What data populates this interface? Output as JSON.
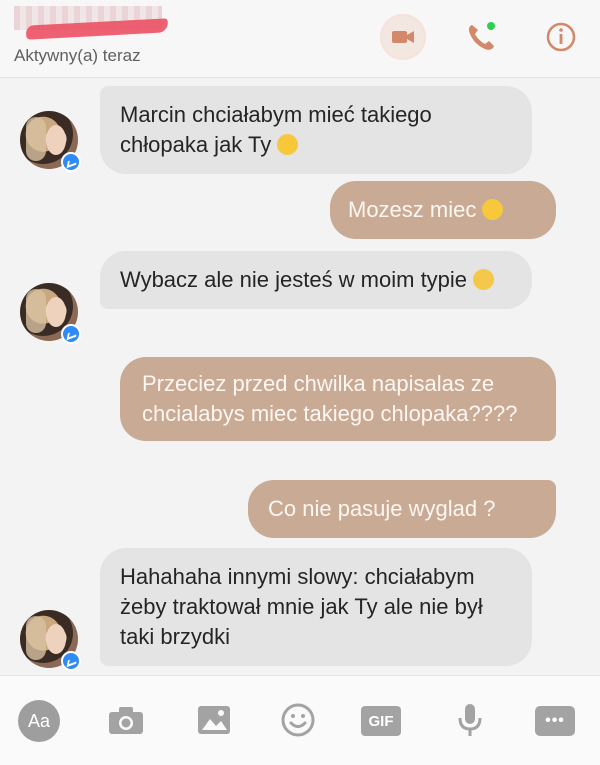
{
  "header": {
    "status": "Aktywny(a) teraz",
    "icons": [
      "video-call-icon",
      "phone-icon",
      "info-icon"
    ],
    "accent": "#d4886a",
    "online_dot": "#2bd14f"
  },
  "messages": [
    {
      "side": "in",
      "text": "Marcin chciałabym mieć takiego chłopaka jak Ty",
      "emoji": "laughing-emoji"
    },
    {
      "side": "out",
      "text": "Mozesz miec",
      "emoji": "smile-emoji"
    },
    {
      "side": "in",
      "text": "Wybacz ale nie jesteś w moim typie",
      "emoji": "sad-emoji"
    },
    {
      "side": "out",
      "text": "Przeciez przed chwilka napisalas ze chcialabys miec takiego chlopaka????"
    },
    {
      "side": "out",
      "text": "Co nie pasuje wyglad ?"
    },
    {
      "side": "in",
      "text": "Hahahaha innymi slowy: chciałabym żeby traktował mnie jak Ty ale nie był taki brzydki"
    }
  ],
  "composer": {
    "aa_label": "Aa",
    "gif_label": "GIF",
    "more_label": "•••",
    "icons": [
      "text-format-icon",
      "camera-icon",
      "image-icon",
      "emoji-icon",
      "gif-icon",
      "microphone-icon",
      "more-icon"
    ]
  },
  "colors": {
    "incoming_bubble": "#e4e4e4",
    "outgoing_bubble": "#c9aa94",
    "outgoing_text": "#fdf6f1"
  }
}
